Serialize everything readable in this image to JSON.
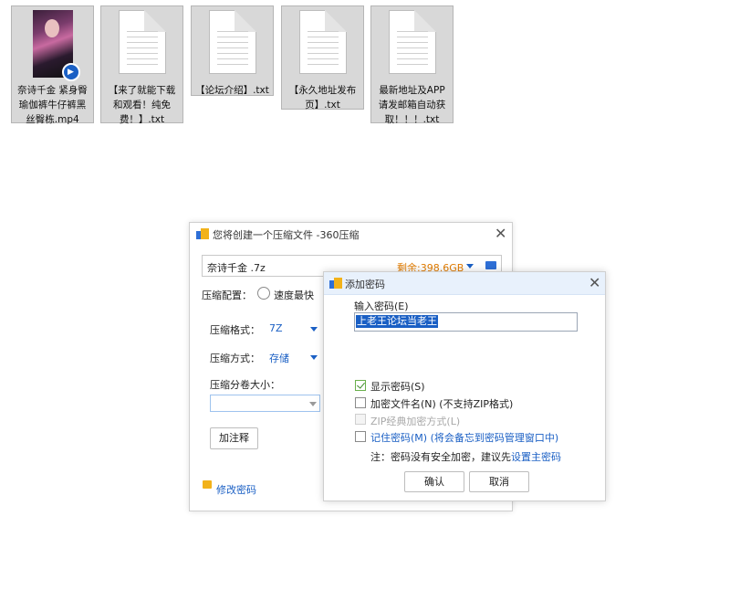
{
  "desktop": {
    "files": [
      {
        "name": "奈诗千金 紧身臀瑜伽裤牛仔裤黑丝臀栋.mp4",
        "lines": [
          "奈诗千金 紧身臀",
          "瑜伽裤牛仔裤黑",
          "丝臀栋.mp4"
        ],
        "icon": "video-thumbnail-icon"
      },
      {
        "name": "【来了就能下载和观看！纯免费！】.txt",
        "lines": [
          "【来了就能下载",
          "和观看！纯免",
          "费！】.txt"
        ],
        "icon": "text-file-icon"
      },
      {
        "name": "【论坛介绍】.txt",
        "lines": [
          "【论坛介绍】.txt"
        ],
        "icon": "text-file-icon"
      },
      {
        "name": "【永久地址发布页】.txt",
        "lines": [
          "【永久地址发布",
          "页】.txt"
        ],
        "icon": "text-file-icon"
      },
      {
        "name": "最新地址及APP请发邮箱自动获取！！！.txt",
        "lines": [
          "最新地址及APP",
          "请发邮箱自动获",
          "取！！！.txt"
        ],
        "icon": "text-file-icon"
      }
    ]
  },
  "compress_dialog": {
    "title": "您将创建一个压缩文件 -360压缩",
    "filename": "奈诗千金 .7z",
    "free_space": "剩余:398.6GB",
    "config_label": "压缩配置：",
    "speed_option": "速度最快",
    "format_label": "压缩格式：",
    "format_value": "7Z",
    "method_label": "压缩方式：",
    "method_value": "存储",
    "volume_label": "压缩分卷大小：",
    "volume_value": "",
    "comment_button": "加注释",
    "change_password": "修改密码"
  },
  "password_dialog": {
    "title": "添加密码",
    "input_label": "输入密码(E)",
    "password_value": "上老王论坛当老王",
    "show_password": "显示密码(S)",
    "show_password_checked": true,
    "encrypt_filenames": "加密文件名(N) (不支持ZIP格式)",
    "encrypt_filenames_checked": false,
    "zip_classic": "ZIP经典加密方式(L)",
    "zip_classic_enabled": false,
    "remember_password": "记住密码(M) (将会备忘到密码管理窗口中)",
    "remember_checked": false,
    "note_prefix": "注：密码没有安全加密，建议先",
    "note_link": "设置主密码",
    "ok_button": "确认",
    "cancel_button": "取消"
  },
  "colors": {
    "accent": "#1a5fc4",
    "orange": "#e07b00",
    "titlebar": "#e8f1fc"
  }
}
